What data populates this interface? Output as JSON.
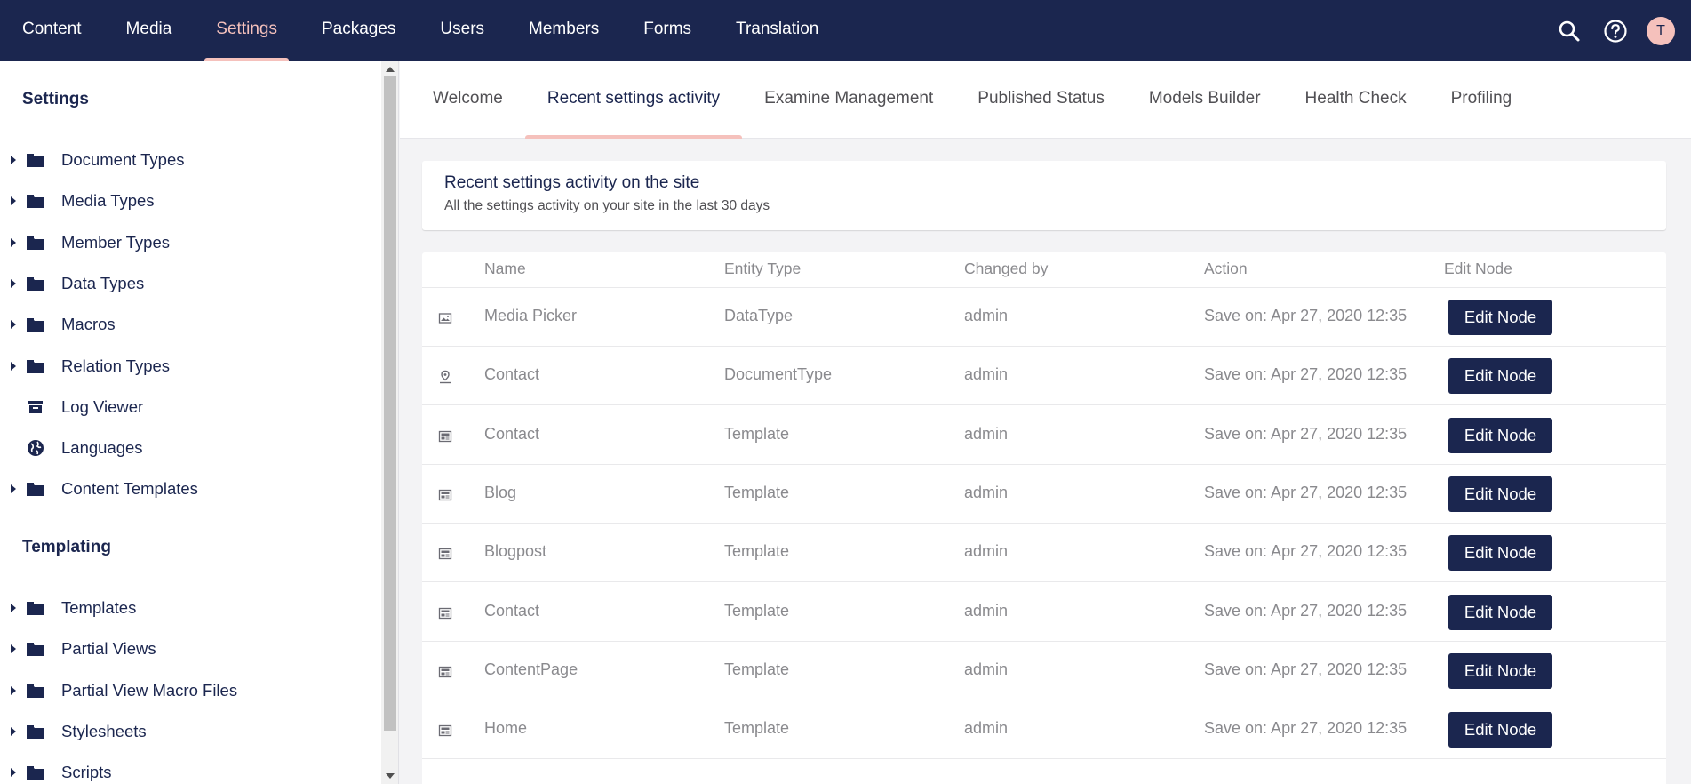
{
  "topnav": {
    "items": [
      {
        "label": "Content"
      },
      {
        "label": "Media"
      },
      {
        "label": "Settings",
        "active": true
      },
      {
        "label": "Packages"
      },
      {
        "label": "Users"
      },
      {
        "label": "Members"
      },
      {
        "label": "Forms"
      },
      {
        "label": "Translation"
      }
    ],
    "avatar_initial": "T"
  },
  "sidebar": {
    "settings_title": "Settings",
    "settings_items": [
      {
        "label": "Document Types",
        "icon": "folder-icon",
        "expandable": true
      },
      {
        "label": "Media Types",
        "icon": "folder-icon",
        "expandable": true
      },
      {
        "label": "Member Types",
        "icon": "folder-icon",
        "expandable": true
      },
      {
        "label": "Data Types",
        "icon": "folder-icon",
        "expandable": true
      },
      {
        "label": "Macros",
        "icon": "folder-icon",
        "expandable": true
      },
      {
        "label": "Relation Types",
        "icon": "folder-icon",
        "expandable": true
      },
      {
        "label": "Log Viewer",
        "icon": "archive-icon",
        "expandable": false
      },
      {
        "label": "Languages",
        "icon": "globe-icon",
        "expandable": false
      },
      {
        "label": "Content Templates",
        "icon": "folder-icon",
        "expandable": true
      }
    ],
    "templating_title": "Templating",
    "templating_items": [
      {
        "label": "Templates",
        "icon": "folder-icon",
        "expandable": true
      },
      {
        "label": "Partial Views",
        "icon": "folder-icon",
        "expandable": true
      },
      {
        "label": "Partial View Macro Files",
        "icon": "folder-icon",
        "expandable": true
      },
      {
        "label": "Stylesheets",
        "icon": "folder-icon",
        "expandable": true
      },
      {
        "label": "Scripts",
        "icon": "folder-icon",
        "expandable": true
      }
    ]
  },
  "tabs": [
    {
      "label": "Welcome"
    },
    {
      "label": "Recent settings activity",
      "active": true
    },
    {
      "label": "Examine Management"
    },
    {
      "label": "Published Status"
    },
    {
      "label": "Models Builder"
    },
    {
      "label": "Health Check"
    },
    {
      "label": "Profiling"
    }
  ],
  "activity": {
    "title": "Recent settings activity on the site",
    "subtitle": "All the settings activity on your site in the last 30 days",
    "columns": {
      "name": "Name",
      "entity_type": "Entity Type",
      "changed_by": "Changed by",
      "action": "Action",
      "edit_node": "Edit Node"
    },
    "button_label": "Edit Node",
    "rows": [
      {
        "icon": "picture-icon",
        "name": "Media Picker",
        "entity_type": "DataType",
        "changed_by": "admin",
        "action": "Save on: Apr 27, 2020 12:35"
      },
      {
        "icon": "location-pin-icon",
        "name": "Contact",
        "entity_type": "DocumentType",
        "changed_by": "admin",
        "action": "Save on: Apr 27, 2020 12:35"
      },
      {
        "icon": "layout-icon",
        "name": "Contact",
        "entity_type": "Template",
        "changed_by": "admin",
        "action": "Save on: Apr 27, 2020 12:35"
      },
      {
        "icon": "layout-icon",
        "name": "Blog",
        "entity_type": "Template",
        "changed_by": "admin",
        "action": "Save on: Apr 27, 2020 12:35"
      },
      {
        "icon": "layout-icon",
        "name": "Blogpost",
        "entity_type": "Template",
        "changed_by": "admin",
        "action": "Save on: Apr 27, 2020 12:35"
      },
      {
        "icon": "layout-icon",
        "name": "Contact",
        "entity_type": "Template",
        "changed_by": "admin",
        "action": "Save on: Apr 27, 2020 12:35"
      },
      {
        "icon": "layout-icon",
        "name": "ContentPage",
        "entity_type": "Template",
        "changed_by": "admin",
        "action": "Save on: Apr 27, 2020 12:35"
      },
      {
        "icon": "layout-icon",
        "name": "Home",
        "entity_type": "Template",
        "changed_by": "admin",
        "action": "Save on: Apr 27, 2020 12:35"
      }
    ]
  },
  "colors": {
    "header_bg": "#1b264f",
    "accent": "#f5c1bc",
    "button_bg": "#1b264f",
    "page_bg": "#f3f3f5"
  }
}
